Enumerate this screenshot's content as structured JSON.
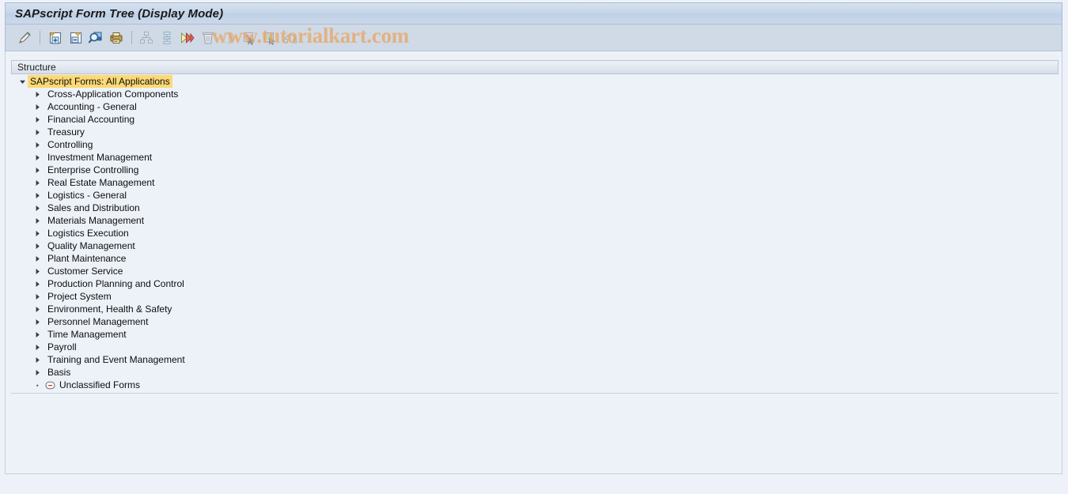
{
  "window": {
    "title": "SAPscript Form Tree (Display Mode)"
  },
  "watermark": {
    "text": "www.tutorialkart.com",
    "color": "#e8a86a"
  },
  "toolbar": {
    "buttons": [
      {
        "name": "change-display-toggle-icon",
        "label": "Display <-> Change",
        "enabled": true
      },
      {
        "name": "expand-node-icon",
        "label": "Expand Node",
        "enabled": true
      },
      {
        "name": "collapse-node-icon",
        "label": "Collapse Node",
        "enabled": true
      },
      {
        "name": "find-icon",
        "label": "Find",
        "enabled": true
      },
      {
        "name": "print-preview-icon",
        "label": "Print Preview",
        "enabled": true
      },
      {
        "name": "hierarchy-icon",
        "label": "Hierarchy",
        "enabled": false
      },
      {
        "name": "sort-structure-icon",
        "label": "Structure Sort",
        "enabled": false
      },
      {
        "name": "execute-icon",
        "label": "Execute",
        "enabled": false
      },
      {
        "name": "delete-icon",
        "label": "Delete",
        "enabled": false
      },
      {
        "name": "status-icon",
        "label": "Status",
        "enabled": false
      },
      {
        "name": "select-item-icon",
        "label": "Select Item",
        "enabled": false
      },
      {
        "name": "document-icon",
        "label": "Document",
        "enabled": false
      },
      {
        "name": "refresh-icon",
        "label": "Refresh",
        "enabled": false
      }
    ]
  },
  "column_header": {
    "label": "Structure"
  },
  "tree": {
    "root": {
      "label": "SAPscript Forms: All Applications",
      "expanded": true,
      "highlight_color": "#fcd975"
    },
    "children": [
      {
        "label": "Cross-Application Components",
        "expanded": false,
        "type": "folder"
      },
      {
        "label": "Accounting - General",
        "expanded": false,
        "type": "folder"
      },
      {
        "label": "Financial Accounting",
        "expanded": false,
        "type": "folder"
      },
      {
        "label": "Treasury",
        "expanded": false,
        "type": "folder"
      },
      {
        "label": "Controlling",
        "expanded": false,
        "type": "folder"
      },
      {
        "label": "Investment Management",
        "expanded": false,
        "type": "folder"
      },
      {
        "label": "Enterprise Controlling",
        "expanded": false,
        "type": "folder"
      },
      {
        "label": "Real Estate Management",
        "expanded": false,
        "type": "folder"
      },
      {
        "label": "Logistics - General",
        "expanded": false,
        "type": "folder"
      },
      {
        "label": "Sales and Distribution",
        "expanded": false,
        "type": "folder"
      },
      {
        "label": "Materials Management",
        "expanded": false,
        "type": "folder"
      },
      {
        "label": "Logistics Execution",
        "expanded": false,
        "type": "folder"
      },
      {
        "label": "Quality Management",
        "expanded": false,
        "type": "folder"
      },
      {
        "label": "Plant Maintenance",
        "expanded": false,
        "type": "folder"
      },
      {
        "label": "Customer Service",
        "expanded": false,
        "type": "folder"
      },
      {
        "label": "Production Planning and Control",
        "expanded": false,
        "type": "folder"
      },
      {
        "label": "Project System",
        "expanded": false,
        "type": "folder"
      },
      {
        "label": "Environment, Health & Safety",
        "expanded": false,
        "type": "folder"
      },
      {
        "label": "Personnel Management",
        "expanded": false,
        "type": "folder"
      },
      {
        "label": "Time Management",
        "expanded": false,
        "type": "folder"
      },
      {
        "label": "Payroll",
        "expanded": false,
        "type": "folder"
      },
      {
        "label": "Training and Event Management",
        "expanded": false,
        "type": "folder"
      },
      {
        "label": "Basis",
        "expanded": false,
        "type": "folder"
      },
      {
        "label": "Unclassified Forms",
        "expanded": false,
        "type": "leaf",
        "icon": "minus-circle-icon"
      }
    ]
  }
}
